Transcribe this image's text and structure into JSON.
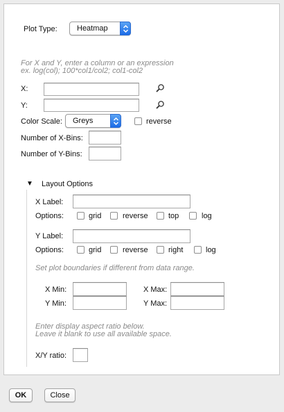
{
  "plot_type": {
    "label": "Plot Type:",
    "value": "Heatmap"
  },
  "hint": {
    "line1": "For X and Y, enter a column or an expression",
    "line2": "ex. log(col); 100*col1/col2; col1-col2"
  },
  "x": {
    "label": "X:",
    "value": ""
  },
  "y": {
    "label": "Y:",
    "value": ""
  },
  "color_scale": {
    "label": "Color Scale:",
    "value": "Greys",
    "reverse_label": "reverse",
    "reverse_checked": false
  },
  "xbins": {
    "label": "Number of X-Bins:",
    "value": ""
  },
  "ybins": {
    "label": "Number of Y-Bins:",
    "value": ""
  },
  "layout": {
    "toggle": "▼",
    "title": "Layout Options",
    "xlabel": {
      "label": "X Label:",
      "value": ""
    },
    "xoptions": {
      "label": "Options:",
      "items": [
        "grid",
        "reverse",
        "top",
        "log"
      ]
    },
    "ylabel": {
      "label": "Y Label:",
      "value": ""
    },
    "yoptions": {
      "label": "Options:",
      "items": [
        "grid",
        "reverse",
        "right",
        "log"
      ]
    },
    "bounds_hint": "Set plot boundaries if different from data range.",
    "xmin": {
      "label": "X Min:",
      "value": ""
    },
    "xmax": {
      "label": "X Max:",
      "value": ""
    },
    "ymin": {
      "label": "Y Min:",
      "value": ""
    },
    "ymax": {
      "label": "Y Max:",
      "value": ""
    },
    "aspect_hint1": "Enter display aspect ratio below.",
    "aspect_hint2": "Leave it blank to use all available space.",
    "ratio": {
      "label": "X/Y ratio:",
      "value": ""
    }
  },
  "buttons": {
    "ok": "OK",
    "close": "Close"
  },
  "colors": {
    "accent": "#1c6ce7",
    "hint": "#8a8a8a",
    "panel": "#ffffff",
    "background": "#ececec"
  }
}
